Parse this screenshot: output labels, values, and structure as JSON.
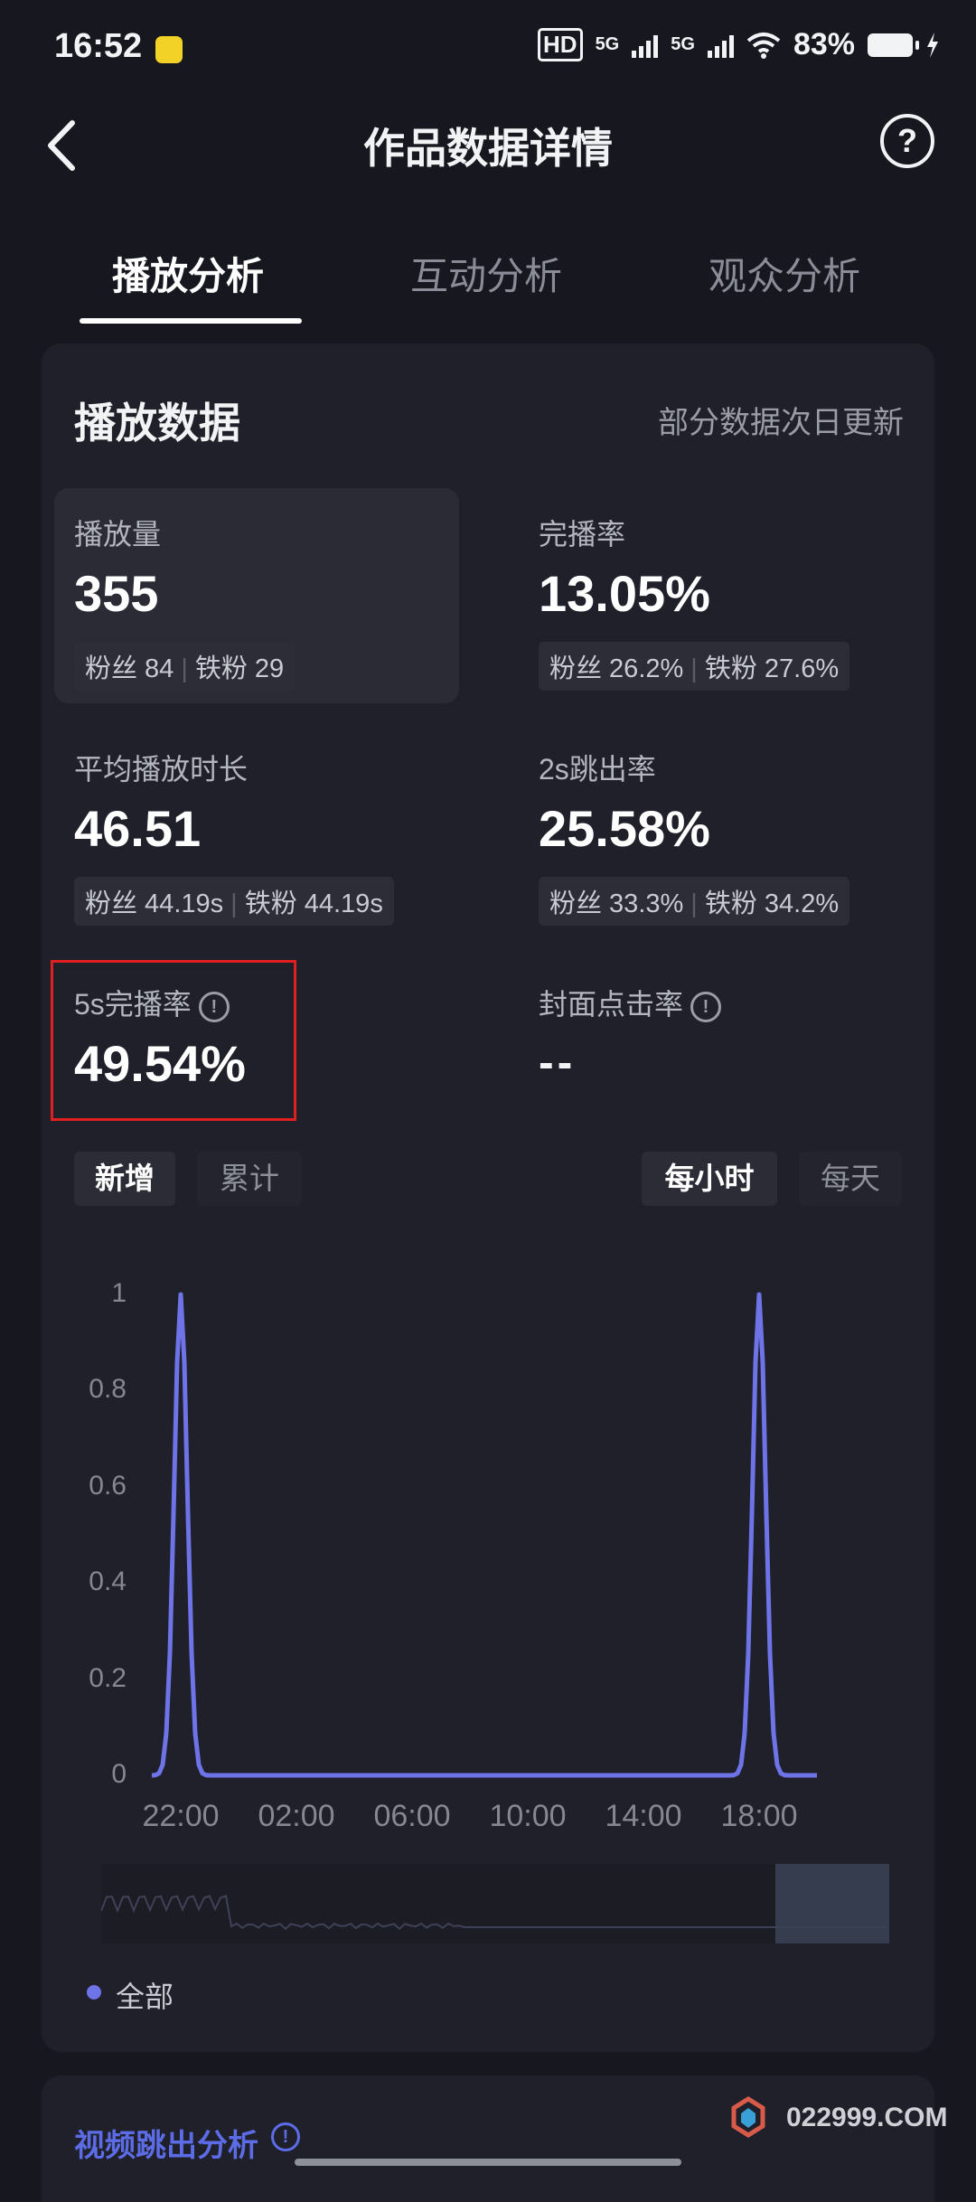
{
  "status_bar": {
    "time": "16:52",
    "hd": "HD",
    "net1": "5G",
    "net2": "5G",
    "battery": "83%"
  },
  "header": {
    "title": "作品数据详情",
    "help_glyph": "?"
  },
  "tabs": [
    {
      "label": "播放分析",
      "active": true
    },
    {
      "label": "互动分析",
      "active": false
    },
    {
      "label": "观众分析",
      "active": false
    }
  ],
  "section": {
    "title": "播放数据",
    "note": "部分数据次日更新"
  },
  "metrics": {
    "plays": {
      "label": "播放量",
      "value": "355",
      "fans": "粉丝 84",
      "iron": "铁粉 29"
    },
    "completion": {
      "label": "完播率",
      "value": "13.05%",
      "fans": "粉丝 26.2%",
      "iron": "铁粉 27.6%"
    },
    "avg_duration": {
      "label": "平均播放时长",
      "value": "46.51",
      "fans": "粉丝 44.19s",
      "iron": "铁粉 44.19s"
    },
    "bounce_2s": {
      "label": "2s跳出率",
      "value": "25.58%",
      "fans": "粉丝 33.3%",
      "iron": "铁粉 34.2%"
    },
    "completion_5s": {
      "label": "5s完播率",
      "value": "49.54%"
    },
    "cover_ctr": {
      "label": "封面点击率",
      "value": "--"
    }
  },
  "toggles": {
    "mode": [
      "新增",
      "累计"
    ],
    "granularity": [
      "每小时",
      "每天"
    ]
  },
  "chart_data": {
    "type": "line",
    "x_ticks": [
      "22:00",
      "02:00",
      "06:00",
      "10:00",
      "14:00",
      "18:00"
    ],
    "y_ticks": [
      "0",
      "0.2",
      "0.4",
      "0.6",
      "0.8",
      "1"
    ],
    "ylim": [
      0,
      1
    ],
    "series": [
      {
        "name": "全部",
        "color": "#6e74e8",
        "x": [
          "21:00",
          "22:00",
          "23:00",
          "00:00",
          "01:00",
          "02:00",
          "03:00",
          "04:00",
          "05:00",
          "06:00",
          "07:00",
          "08:00",
          "09:00",
          "10:00",
          "11:00",
          "12:00",
          "13:00",
          "14:00",
          "15:00",
          "16:00",
          "17:00",
          "18:00",
          "19:00",
          "20:00"
        ],
        "values": [
          0,
          1,
          0,
          0,
          0,
          0,
          0,
          0,
          0,
          0,
          0,
          0,
          0,
          0,
          0,
          0,
          0,
          0,
          0,
          0,
          0,
          1,
          0,
          0
        ]
      }
    ],
    "legend": "bottom-left"
  },
  "bottom_section": {
    "title": "视频跳出分析"
  },
  "watermark": {
    "text": "022999.COM"
  }
}
